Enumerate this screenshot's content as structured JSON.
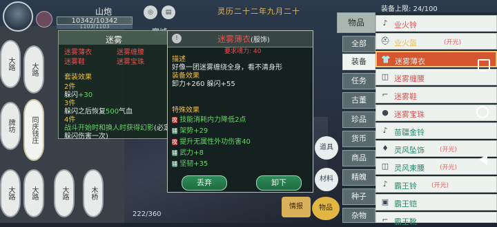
{
  "player": {
    "name": "山炮",
    "hp": "10342/10342",
    "mp": "1103/1103",
    "zone": "寒城"
  },
  "top": {
    "date": "灵历二十二年九月二十"
  },
  "map": {
    "nodes": [
      "大路",
      "大路",
      "牌坊",
      "同庆钱庄",
      "大路",
      "大路",
      "大路",
      "木桥"
    ]
  },
  "set_panel": {
    "title": "迷雾",
    "pieces": [
      "迷雾薄衣",
      "迷雾缠腰",
      "迷雾鞋",
      "迷雾宝珠"
    ],
    "effect_title": "套装效果",
    "lines": [
      {
        "count": "2件",
        "text": "躲闪",
        "value": "+30"
      },
      {
        "count": "3件",
        "text": "躲闪之后恢复",
        "value": "500",
        "suffix": "气血"
      },
      {
        "count": "4件",
        "text": "战斗开始时和换人时获得",
        "value": "幻影",
        "suffix": "(必定",
        "extra": "躲闪伤害一次)"
      }
    ]
  },
  "item_panel": {
    "name": "迷雾薄衣",
    "type": "(服饰)",
    "require": "要求魂力: 40",
    "desc_title": "描述",
    "desc": "好像一团迷雾缠绕全身，看不清身形",
    "effect_title": "装备效果",
    "effects": "卸力+260 躲闪+55",
    "special_title": "特殊效果",
    "specials": [
      {
        "tag": "攻",
        "text": "技能消耗内力降低",
        "value": "2点"
      },
      {
        "tag": "辅",
        "text": "架势",
        "value": "+29"
      },
      {
        "tag": "攻",
        "text": "提升无属性外功伤害",
        "value": "40"
      },
      {
        "tag": "辅",
        "text": "武力",
        "value": "+8"
      },
      {
        "tag": "辅",
        "text": "坚韧",
        "value": "+35"
      }
    ],
    "btn_discard": "丢弃",
    "btn_unequip": "卸下"
  },
  "bottom_icons": {
    "props": "道具",
    "materials": "材料",
    "bag": "物品",
    "intel": "情报",
    "pet_count": "222/360"
  },
  "tabs": {
    "header": "物品",
    "items": [
      "全部",
      "装备",
      "任务",
      "古董",
      "珍品",
      "货币",
      "商品",
      "精魄",
      "种子",
      "杂物"
    ],
    "active": "装备"
  },
  "list": {
    "cap": "装备上限: 24/100",
    "items": [
      {
        "name": "业火铃",
        "note": ""
      },
      {
        "name": "业火盔",
        "note": "(开光)"
      },
      {
        "name": "迷雾薄衣",
        "note": ""
      },
      {
        "name": "迷雾缠腰",
        "note": ""
      },
      {
        "name": "迷雾鞋",
        "note": ""
      },
      {
        "name": "迷雾宝珠",
        "note": ""
      },
      {
        "name": "苗疆金铃",
        "note": ""
      },
      {
        "name": "灵风坠饰",
        "note": "(开光)"
      },
      {
        "name": "灵风束腰",
        "note": "(开光)"
      },
      {
        "name": "霸王铃",
        "note": "(开光)"
      },
      {
        "name": "霸王铠",
        "note": ""
      },
      {
        "name": "霸王靴",
        "note": ""
      }
    ],
    "selected": "迷雾薄衣"
  },
  "colors": {
    "red_item": "#e85050",
    "yellow_item": "#f0c040",
    "orange_sel": "#d6572f",
    "green_text": "#66d36a"
  }
}
